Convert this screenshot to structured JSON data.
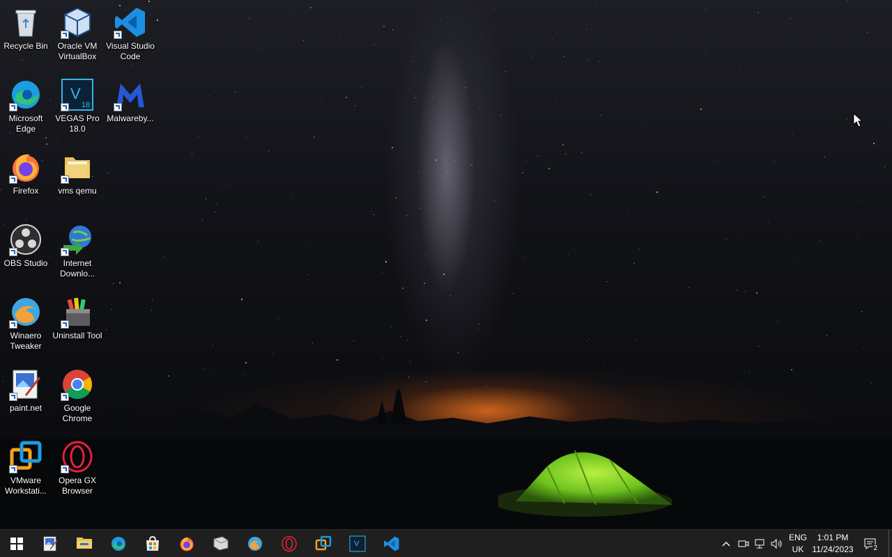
{
  "desktop": {
    "icons": [
      {
        "label": "Recycle Bin",
        "icon": "recycle-bin-icon"
      },
      {
        "label": "Oracle VM VirtualBox",
        "icon": "virtualbox-icon"
      },
      {
        "label": "Visual Studio Code",
        "icon": "vscode-icon"
      },
      {
        "label": "Microsoft Edge",
        "icon": "edge-icon"
      },
      {
        "label": "VEGAS Pro 18.0",
        "icon": "vegas-pro-icon",
        "badge": "18"
      },
      {
        "label": "Malwareby...",
        "icon": "malwarebytes-icon"
      },
      {
        "label": "Firefox",
        "icon": "firefox-icon"
      },
      {
        "label": "vms qemu",
        "icon": "folder-icon"
      },
      {
        "label": "OBS Studio",
        "icon": "obs-icon"
      },
      {
        "label": "Internet Downlo...",
        "icon": "internet-download-manager-icon"
      },
      {
        "label": "Winaero Tweaker",
        "icon": "winaero-tweaker-icon"
      },
      {
        "label": "Uninstall Tool",
        "icon": "uninstall-tool-icon"
      },
      {
        "label": "paint.net",
        "icon": "paintnet-icon"
      },
      {
        "label": "Google Chrome",
        "icon": "chrome-icon"
      },
      {
        "label": "VMware Workstati...",
        "icon": "vmware-icon"
      },
      {
        "label": "Opera GX Browser",
        "icon": "opera-gx-icon"
      }
    ]
  },
  "taskbar": {
    "start": "windows-start-icon",
    "pinned": [
      {
        "name": "paintnet-icon"
      },
      {
        "name": "file-explorer-icon"
      },
      {
        "name": "edge-icon"
      },
      {
        "name": "microsoft-store-icon"
      },
      {
        "name": "firefox-icon"
      },
      {
        "name": "mail-app-icon"
      },
      {
        "name": "winaero-tweaker-icon"
      },
      {
        "name": "opera-gx-icon"
      },
      {
        "name": "vmware-icon"
      },
      {
        "name": "vegas-pro-icon"
      },
      {
        "name": "vscode-icon"
      }
    ],
    "tray": {
      "language_line1": "ENG",
      "language_line2": "UK",
      "time": "1:01 PM",
      "date": "11/24/2023",
      "notification_count": "2"
    }
  },
  "colors": {
    "taskbar_bg": "#1f1f1f",
    "accent_blue": "#0078d4"
  }
}
